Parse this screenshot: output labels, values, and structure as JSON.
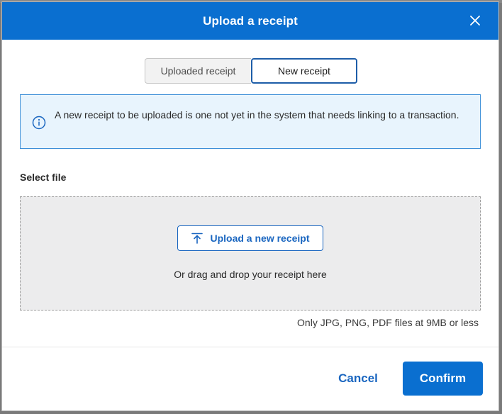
{
  "dialog": {
    "title": "Upload a receipt"
  },
  "tabs": {
    "uploaded_label": "Uploaded receipt",
    "new_label": "New receipt",
    "selected": "New receipt"
  },
  "info": {
    "message": "A new receipt to be uploaded is one not yet in the system that needs linking to a transaction."
  },
  "upload": {
    "section_label": "Select file",
    "button_label": "Upload a new receipt",
    "drag_text": "Or drag and drop your receipt here",
    "file_hint": "Only JPG, PNG, PDF files at 9MB or less"
  },
  "footer": {
    "cancel_label": "Cancel",
    "confirm_label": "Confirm"
  },
  "icons": {
    "close": "close-icon",
    "info": "info-icon",
    "upload": "upload-arrow-icon"
  },
  "colors": {
    "primary": "#0a6fd0",
    "info_bg": "#e8f4fd",
    "info_border": "#3d8fd8",
    "dropzone_bg": "#ececed"
  }
}
